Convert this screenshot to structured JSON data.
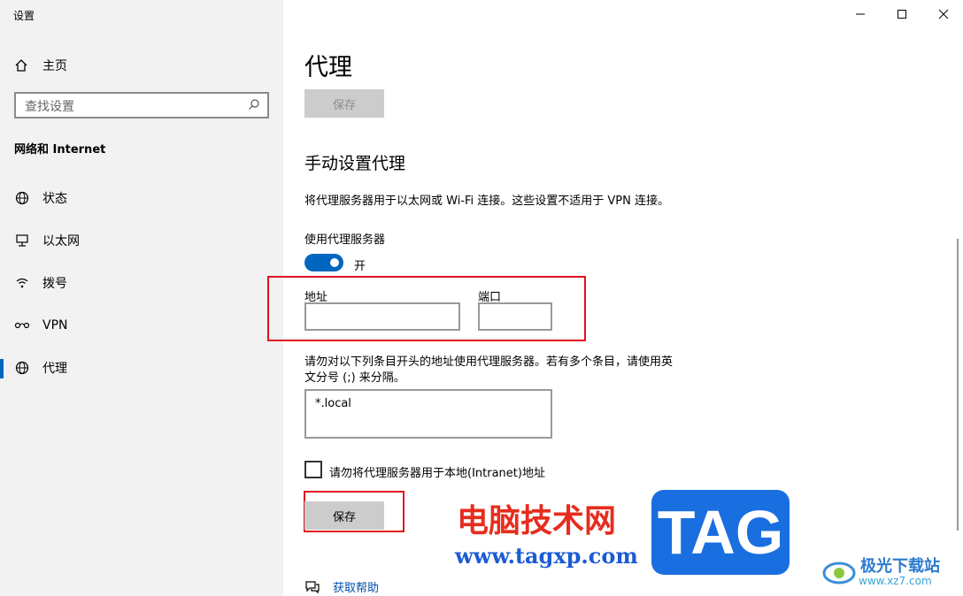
{
  "window": {
    "title": "设置"
  },
  "sidebar": {
    "home_label": "主页",
    "search_placeholder": "查找设置",
    "section_title": "网络和 Internet",
    "items": [
      {
        "label": "状态",
        "icon": "globe-status-icon"
      },
      {
        "label": "以太网",
        "icon": "ethernet-icon"
      },
      {
        "label": "拨号",
        "icon": "dialup-icon"
      },
      {
        "label": "VPN",
        "icon": "vpn-icon"
      },
      {
        "label": "代理",
        "icon": "globe-icon",
        "active": true
      }
    ]
  },
  "main": {
    "page_title": "代理",
    "save_top_label": "保存",
    "manual_title": "手动设置代理",
    "description": "将代理服务器用于以太网或 Wi-Fi 连接。这些设置不适用于 VPN 连接。",
    "use_proxy_label": "使用代理服务器",
    "toggle_state_label": "开",
    "address_label": "地址",
    "address_value": "",
    "port_label": "端口",
    "port_value": "",
    "exceptions_desc_line1": "请勿对以下列条目开头的地址使用代理服务器。若有多个条目，请使用英",
    "exceptions_desc_line2": "文分号 (;) 来分隔。",
    "exceptions_value": "*.local",
    "bypass_local_label": "请勿将代理服务器用于本地(Intranet)地址",
    "save_label": "保存",
    "help_label": "获取帮助"
  },
  "watermark": {
    "cn_text": "电脑技术网",
    "url_text": "www.tagxp.com",
    "tag_text": "TAG",
    "logo2_title": "极光下载站",
    "logo2_url": "www.xz7.com"
  },
  "colors": {
    "accent": "#0067c0",
    "highlight": "#e0121e",
    "sidebar_bg": "#f2f2f2"
  }
}
